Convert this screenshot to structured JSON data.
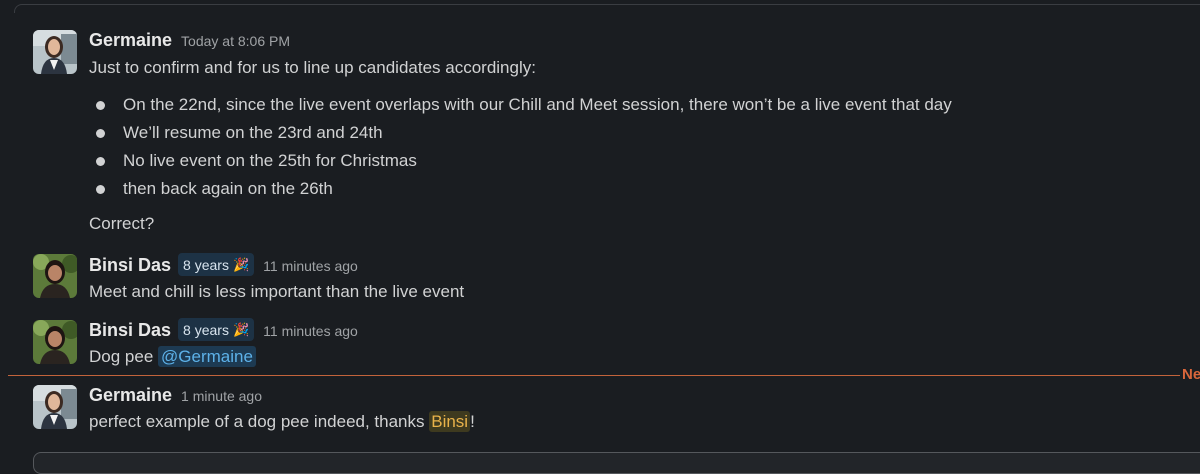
{
  "messages": [
    {
      "author": "Germaine",
      "timestamp": "Today at 8:06 PM",
      "intro": "Just to confirm and for us to line up candidates accordingly:",
      "bullets": [
        "On the 22nd, since the live event overlaps with our Chill and Meet session, there won’t be a live event that day",
        "We’ll resume on the 23rd and 24th",
        "No live event on the 25th for Christmas",
        "then back again on the 26th"
      ],
      "outro": "Correct?"
    },
    {
      "author": "Binsi Das",
      "badge": "8 years",
      "badge_icon": "party-popper-icon",
      "timestamp": "11 minutes ago",
      "text": "Meet and chill is less important than the live event"
    },
    {
      "author": "Binsi Das",
      "badge": "8 years",
      "badge_icon": "party-popper-icon",
      "timestamp": "11 minutes ago",
      "text": "Dog pee",
      "mention": "@Germaine"
    },
    {
      "author": "Germaine",
      "timestamp": "1 minute ago",
      "text_before": "perfect example of a dog pee indeed, thanks ",
      "highlight": "Binsi",
      "text_after": "!"
    }
  ],
  "new_divider_label": "Ne",
  "colors": {
    "background": "#1a1d21",
    "mention": "#5db1e8",
    "highlight": "#e8b24a",
    "new_divider": "#d9663b",
    "badge_bg": "#1d3245"
  }
}
